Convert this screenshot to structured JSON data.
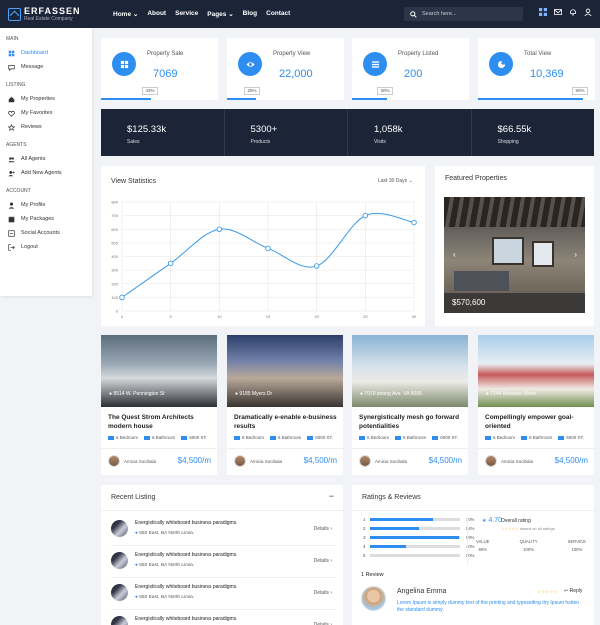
{
  "header": {
    "brand": "ERFASSEN",
    "tagline": "Real Estate Company",
    "nav": [
      "Home",
      "About",
      "Service",
      "Pages",
      "Blog",
      "Contact"
    ],
    "search_placeholder": "Search here..."
  },
  "sidebar": {
    "sections": [
      {
        "title": "MAIN",
        "items": [
          {
            "label": "Dashboard",
            "icon": "dashboard-icon",
            "active": true
          },
          {
            "label": "Message",
            "icon": "message-icon"
          }
        ]
      },
      {
        "title": "LISTING",
        "items": [
          {
            "label": "My Properties",
            "icon": "home-icon"
          },
          {
            "label": "My Favorites",
            "icon": "heart-icon"
          },
          {
            "label": "Reviews",
            "icon": "star-icon"
          }
        ]
      },
      {
        "title": "AGENTS",
        "items": [
          {
            "label": "All Agents",
            "icon": "users-icon"
          },
          {
            "label": "Add New Agents",
            "icon": "add-user-icon"
          }
        ]
      },
      {
        "title": "ACCOUNT",
        "items": [
          {
            "label": "My Profile",
            "icon": "user-icon"
          },
          {
            "label": "My Packages",
            "icon": "package-icon"
          },
          {
            "label": "Social Accounts",
            "icon": "share-icon"
          },
          {
            "label": "Logout",
            "icon": "logout-icon"
          }
        ]
      }
    ]
  },
  "stats": [
    {
      "label": "Property Sale",
      "value": "7069",
      "pct": "43%",
      "progress": 0.43,
      "icon": "grid-icon"
    },
    {
      "label": "Property View",
      "value": "22,000",
      "pct": "25%",
      "progress": 0.25,
      "icon": "eye-icon"
    },
    {
      "label": "Property Listed",
      "value": "200",
      "pct": "30%",
      "progress": 0.3,
      "icon": "list-icon"
    },
    {
      "label": "Total View",
      "value": "10,369",
      "pct": "90%",
      "progress": 0.9,
      "icon": "pie-icon"
    }
  ],
  "summary": [
    {
      "value": "$125.33k",
      "label": "Sales"
    },
    {
      "value": "5300+",
      "label": "Products"
    },
    {
      "value": "1,058k",
      "label": "Visits"
    },
    {
      "value": "$66.55k",
      "label": "Shopping"
    }
  ],
  "view_statistics": {
    "title": "View Statistics",
    "filter": "Last 30 Days"
  },
  "chart_data": {
    "type": "line",
    "title": "View Statistics",
    "x": [
      0,
      5,
      10,
      15,
      20,
      25,
      30
    ],
    "y": [
      100,
      350,
      600,
      460,
      330,
      700,
      650
    ],
    "x_ticks": [
      "0",
      "5",
      "10",
      "15",
      "20",
      "25",
      "30"
    ],
    "y_ticks": [
      "0",
      "100",
      "200",
      "300",
      "400",
      "500",
      "600",
      "700",
      "800"
    ],
    "ylim": [
      0,
      800
    ],
    "xlim": [
      0,
      30
    ],
    "grid": true,
    "color": "#3b9be8"
  },
  "featured": {
    "title": "Featured Properties",
    "price": "$570,600"
  },
  "properties": [
    {
      "address": "8514 W. Pennington St",
      "title": "The Quest Strom Architects modern house",
      "bed": "6 Bedroom",
      "bath": "6 Bathroom",
      "area": "6000 ST.",
      "agent": "Amicia Socibala",
      "price": "$4,500/m"
    },
    {
      "address": "9185 Myers Dr",
      "title": "Dramatically e-enable e-business results",
      "bed": "6 Bedroom",
      "bath": "6 Bathroom",
      "area": "6000 ST.",
      "agent": "Amicia Socibala",
      "price": "$4,500/m"
    },
    {
      "address": "7070 strong Ave. VA 5005",
      "title": "Synergistically mesh go forward potentialities",
      "bed": "6 Bedroom",
      "bath": "6 Bathroom",
      "area": "6000 ST.",
      "agent": "Amicia Socibala",
      "price": "$4,500/m"
    },
    {
      "address": "7144 Meadow Street",
      "title": "Compellingly empower goal-oriented",
      "bed": "6 Bedroom",
      "bath": "6 Bathroom",
      "area": "6000 ST.",
      "agent": "Amicia Socibala",
      "price": "$4,500/m"
    }
  ],
  "recent_listing": {
    "title": "Recent Listing",
    "collapse": "−",
    "items": [
      {
        "title": "Energistically whiteboard business paradigms.",
        "address": "550 East, BA North Limia.",
        "action": "Details"
      },
      {
        "title": "Energistically whiteboard business paradigms.",
        "address": "550 East, BA North Limia.",
        "action": "Details"
      },
      {
        "title": "Energistically whiteboard business paradigms.",
        "address": "550 East, BA North Limia.",
        "action": "Details"
      },
      {
        "title": "Energistically whiteboard business paradigms.",
        "address": "550 East, BA North Limia.",
        "action": "Details"
      }
    ]
  },
  "ratings": {
    "title": "Ratings & Reviews",
    "bars": [
      {
        "n": "1",
        "pct": "70%",
        "value": 0.7
      },
      {
        "n": "2",
        "pct": "54%",
        "value": 0.54
      },
      {
        "n": "3",
        "pct": "99%",
        "value": 0.99
      },
      {
        "n": "4",
        "pct": "40%",
        "value": 0.4
      },
      {
        "n": "5",
        "pct": "00%",
        "value": 0.0
      }
    ],
    "overall_score": "4.70",
    "overall_label": "Overall rating",
    "overall_sub": "based on all ratings",
    "metrics": [
      {
        "label": "VALUE",
        "value": "80%"
      },
      {
        "label": "QUALITY",
        "value": "100%"
      },
      {
        "label": "SERVICE",
        "value": "100%"
      }
    ],
    "review_count": "1 Review",
    "reviewer": "Angelina Emma",
    "reply": "Reply",
    "review_text": "Lorem Ipsum is simply dummy text of the printing and typesetting itry Ipsum hsben the standard dummy."
  }
}
